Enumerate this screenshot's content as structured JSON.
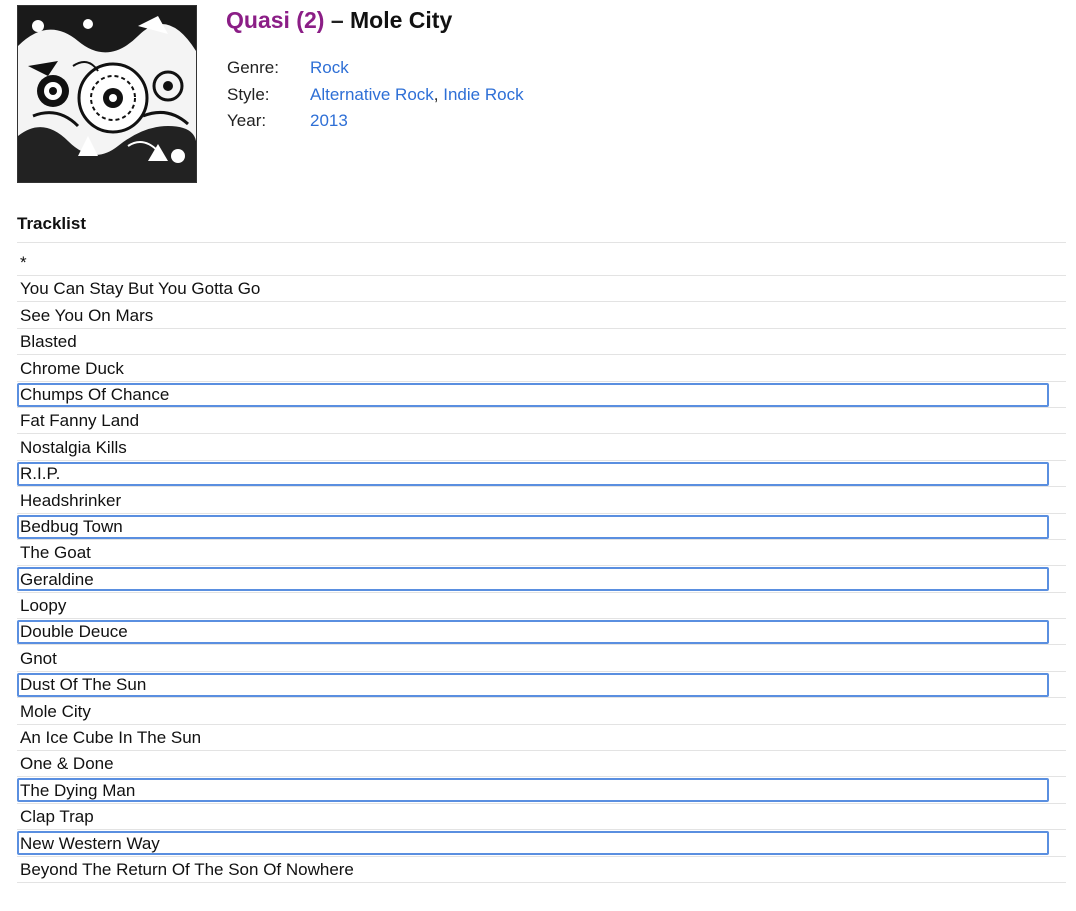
{
  "release": {
    "artist": "Quasi (2)",
    "separator": "–",
    "title": "Mole City",
    "cover_icon": "album-cover-art"
  },
  "meta": {
    "genre_label": "Genre:",
    "genre": "Rock",
    "style_label": "Style:",
    "styles": [
      "Alternative Rock",
      "Indie Rock"
    ],
    "style_separator": ",",
    "year_label": "Year:",
    "year": "2013"
  },
  "tracklist": {
    "heading": "Tracklist",
    "tracks": [
      {
        "title": "*",
        "selected": false
      },
      {
        "title": "You Can Stay But You Gotta Go",
        "selected": false
      },
      {
        "title": "See You On Mars",
        "selected": false
      },
      {
        "title": "Blasted",
        "selected": false
      },
      {
        "title": "Chrome Duck",
        "selected": false
      },
      {
        "title": "Chumps Of Chance",
        "selected": true
      },
      {
        "title": "Fat Fanny Land",
        "selected": false
      },
      {
        "title": "Nostalgia Kills",
        "selected": false
      },
      {
        "title": "R.I.P.",
        "selected": true
      },
      {
        "title": "Headshrinker",
        "selected": false
      },
      {
        "title": "Bedbug Town",
        "selected": true
      },
      {
        "title": "The Goat",
        "selected": false
      },
      {
        "title": "Geraldine",
        "selected": true
      },
      {
        "title": "Loopy",
        "selected": false
      },
      {
        "title": "Double Deuce",
        "selected": true
      },
      {
        "title": "Gnot",
        "selected": false
      },
      {
        "title": "Dust Of The Sun",
        "selected": true
      },
      {
        "title": "Mole City",
        "selected": false
      },
      {
        "title": "An Ice Cube In The Sun",
        "selected": false
      },
      {
        "title": "One & Done",
        "selected": false
      },
      {
        "title": "The Dying Man",
        "selected": true
      },
      {
        "title": "Clap Trap",
        "selected": false
      },
      {
        "title": "New Western Way",
        "selected": true
      },
      {
        "title": "Beyond The Return Of The Son Of Nowhere",
        "selected": false
      }
    ]
  },
  "colors": {
    "artist_link": "#8b1e86",
    "link": "#2e6fd6",
    "selection_border": "#5a8fe0",
    "row_divider": "#e3e3e3"
  }
}
